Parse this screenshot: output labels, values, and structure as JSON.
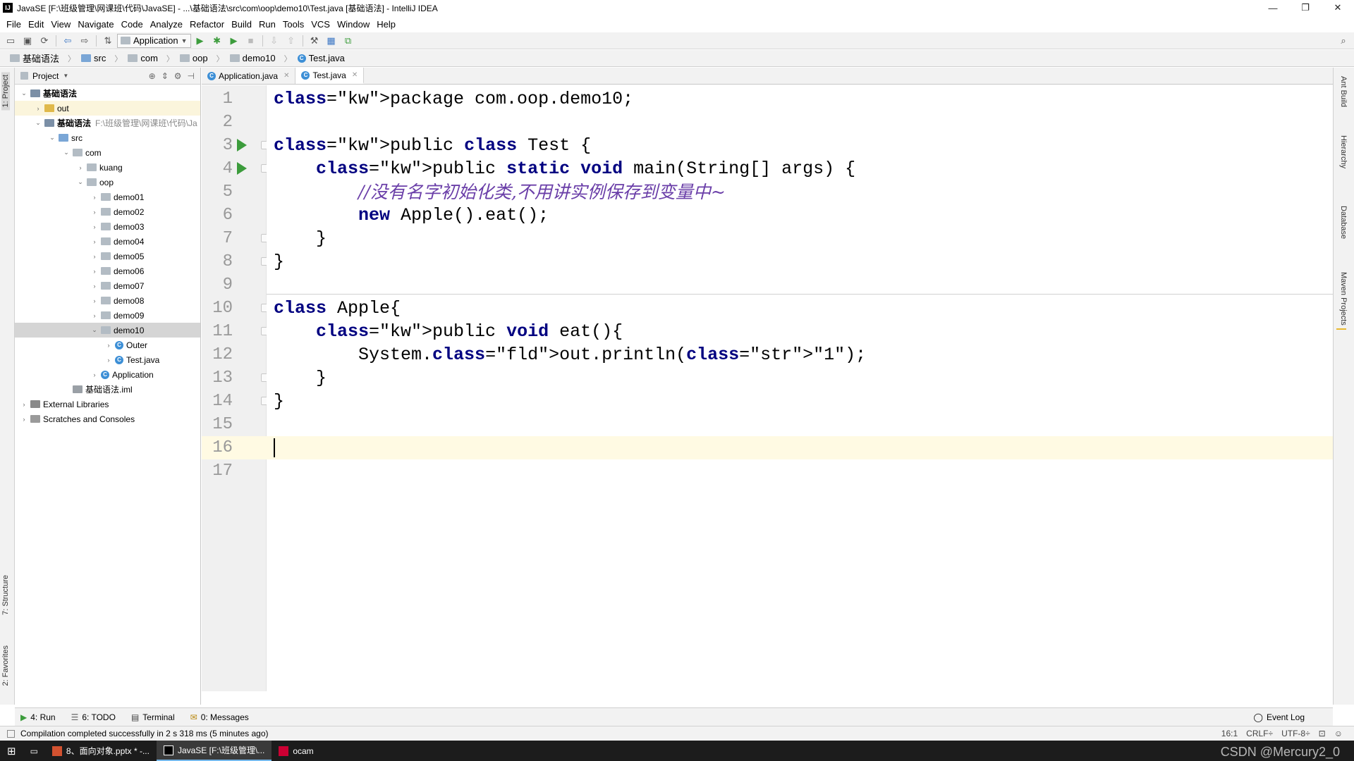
{
  "window": {
    "title": "JavaSE [F:\\班级管理\\网课班\\代码\\JavaSE] - ...\\基础语法\\src\\com\\oop\\demo10\\Test.java [基础语法] - IntelliJ IDEA",
    "minimize": "—",
    "maximize": "❐",
    "close": "✕"
  },
  "menu": [
    "File",
    "Edit",
    "View",
    "Navigate",
    "Code",
    "Analyze",
    "Refactor",
    "Build",
    "Run",
    "Tools",
    "VCS",
    "Window",
    "Help"
  ],
  "toolbar": {
    "run_config": "Application"
  },
  "breadcrumb": [
    "基础语法",
    "src",
    "com",
    "oop",
    "demo10",
    "Test.java"
  ],
  "left_strip": {
    "project_tab": "1: Project",
    "structure_tab": "7: Structure",
    "favorites_tab": "2: Favorites"
  },
  "project_panel": {
    "header": "Project",
    "tree": [
      {
        "label": "基础语法",
        "indent": 0,
        "arrow": "v",
        "icon": "module"
      },
      {
        "label": "out",
        "indent": 1,
        "arrow": ">",
        "icon": "folder"
      },
      {
        "label": "基础语法",
        "extra": "F:\\班级管理\\网课班\\代码\\Ja",
        "indent": 1,
        "arrow": "v",
        "icon": "module"
      },
      {
        "label": "src",
        "indent": 2,
        "arrow": "v",
        "icon": "folder-src"
      },
      {
        "label": "com",
        "indent": 3,
        "arrow": "v",
        "icon": "package"
      },
      {
        "label": "kuang",
        "indent": 4,
        "arrow": ">",
        "icon": "package"
      },
      {
        "label": "oop",
        "indent": 4,
        "arrow": "v",
        "icon": "package"
      },
      {
        "label": "demo01",
        "indent": 5,
        "arrow": ">",
        "icon": "package"
      },
      {
        "label": "demo02",
        "indent": 5,
        "arrow": ">",
        "icon": "package"
      },
      {
        "label": "demo03",
        "indent": 5,
        "arrow": ">",
        "icon": "package"
      },
      {
        "label": "demo04",
        "indent": 5,
        "arrow": ">",
        "icon": "package"
      },
      {
        "label": "demo05",
        "indent": 5,
        "arrow": ">",
        "icon": "package"
      },
      {
        "label": "demo06",
        "indent": 5,
        "arrow": ">",
        "icon": "package"
      },
      {
        "label": "demo07",
        "indent": 5,
        "arrow": ">",
        "icon": "package"
      },
      {
        "label": "demo08",
        "indent": 5,
        "arrow": ">",
        "icon": "package"
      },
      {
        "label": "demo09",
        "indent": 5,
        "arrow": ">",
        "icon": "package"
      },
      {
        "label": "demo10",
        "indent": 5,
        "arrow": "v",
        "icon": "package",
        "selected": true
      },
      {
        "label": "Outer",
        "indent": 6,
        "arrow": ">",
        "icon": "class"
      },
      {
        "label": "Test.java",
        "indent": 6,
        "arrow": ">",
        "icon": "class"
      },
      {
        "label": "Application",
        "indent": 5,
        "arrow": ">",
        "icon": "class"
      },
      {
        "label": "基础语法.iml",
        "indent": 3,
        "arrow": "",
        "icon": "file"
      },
      {
        "label": "External Libraries",
        "indent": 0,
        "arrow": ">",
        "icon": "library"
      },
      {
        "label": "Scratches and Consoles",
        "indent": 0,
        "arrow": ">",
        "icon": "scratch"
      }
    ]
  },
  "editor_tabs": [
    {
      "label": "Application.java",
      "active": false
    },
    {
      "label": "Test.java",
      "active": true
    }
  ],
  "code_lines": [
    "package com.oop.demo10;",
    "",
    "public class Test {",
    "    public static void main(String[] args) {",
    "        //没有名字初始化类,不用讲实例保存到变量中~",
    "        new Apple().eat();",
    "    }",
    "}",
    "",
    "class Apple{",
    "    public void eat(){",
    "        System.out.println(\"1\");",
    "    }",
    "}",
    "",
    "",
    ""
  ],
  "current_line": 16,
  "right_strip": [
    "Ant Build",
    "Hierarchy",
    "Database",
    "Maven Projects"
  ],
  "bottom_tabs": [
    "4: Run",
    "6: TODO",
    "Terminal",
    "0: Messages",
    "Event Log"
  ],
  "status": {
    "message": "Compilation completed successfully in 2 s 318 ms (5 minutes ago)",
    "position": "16:1",
    "line_sep": "CRLF÷",
    "encoding": "UTF-8÷"
  },
  "taskbar": {
    "items": [
      "8、面向对象.pptx * -...",
      "JavaSE [F:\\班级管理\\...",
      "ocam"
    ],
    "watermark": "CSDN @Mercury2_0"
  }
}
